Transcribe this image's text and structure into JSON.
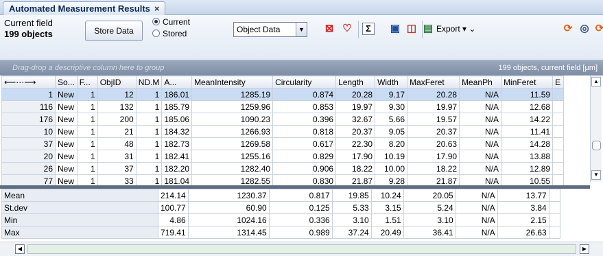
{
  "tab": {
    "title": "Automated Measurement Results",
    "close": "×"
  },
  "toolbar": {
    "field_label": "Current field",
    "objects": "199 objects",
    "store_button": "Store Data",
    "radio_current": "Current",
    "radio_stored": "Stored",
    "select_value": "Object Data",
    "export_label": "Export"
  },
  "grid": {
    "group_hint": "Drag-drop a descriptive column here to group",
    "summary": "199 objects, current field [µm]",
    "headers": [
      "⟵⋯⟶",
      "So...",
      "F...",
      "ObjID",
      "ND.M",
      "A...",
      "MeanIntensity",
      "Circularity",
      "Length",
      "Width",
      "MaxFeret",
      "MeanPh",
      "MinFeret",
      "E"
    ],
    "rows": [
      [
        "1",
        "New",
        "1",
        "12",
        "1",
        "186.01",
        "1285.19",
        "0.874",
        "20.28",
        "9.17",
        "20.28",
        "N/A",
        "11.59"
      ],
      [
        "116",
        "New",
        "1",
        "132",
        "1",
        "185.79",
        "1259.96",
        "0.853",
        "19.97",
        "9.30",
        "19.97",
        "N/A",
        "12.68"
      ],
      [
        "176",
        "New",
        "1",
        "200",
        "1",
        "185.06",
        "1090.23",
        "0.396",
        "32.67",
        "5.66",
        "19.57",
        "N/A",
        "14.22"
      ],
      [
        "10",
        "New",
        "1",
        "21",
        "1",
        "184.32",
        "1266.93",
        "0.818",
        "20.37",
        "9.05",
        "20.37",
        "N/A",
        "11.41"
      ],
      [
        "37",
        "New",
        "1",
        "48",
        "1",
        "182.73",
        "1269.58",
        "0.617",
        "22.30",
        "8.20",
        "20.63",
        "N/A",
        "14.28"
      ],
      [
        "20",
        "New",
        "1",
        "31",
        "1",
        "182.41",
        "1255.16",
        "0.829",
        "17.90",
        "10.19",
        "17.90",
        "N/A",
        "13.88"
      ],
      [
        "26",
        "New",
        "1",
        "37",
        "1",
        "182.20",
        "1282.40",
        "0.906",
        "18.22",
        "10.00",
        "18.22",
        "N/A",
        "12.89"
      ],
      [
        "77",
        "New",
        "1",
        "33",
        "1",
        "181.04",
        "1282.55",
        "0.830",
        "21.87",
        "9.28",
        "21.87",
        "N/A",
        "10.55"
      ]
    ]
  },
  "stats": {
    "rows": [
      [
        "Mean",
        "214.14",
        "1230.37",
        "0.817",
        "19.85",
        "10.24",
        "20.05",
        "N/A",
        "13.77"
      ],
      [
        "St.dev",
        "100.77",
        "60.90",
        "0.125",
        "5.33",
        "3.15",
        "5.24",
        "N/A",
        "3.84"
      ],
      [
        "Min",
        "4.86",
        "1024.16",
        "0.336",
        "3.10",
        "1.51",
        "3.10",
        "N/A",
        "2.15"
      ],
      [
        "Max",
        "719.41",
        "1314.45",
        "0.989",
        "37.24",
        "20.49",
        "36.41",
        "N/A",
        "26.63"
      ]
    ]
  },
  "icons": {
    "toolbar": [
      "delete-red-icon",
      "heart-check-icon",
      "sum-icon",
      "chart-icon",
      "table-layout-icon",
      "export-icon",
      "refresh-icon",
      "target-icon",
      "recalc-icon"
    ]
  },
  "colors": {
    "selected_row": "#c9dcf3",
    "group_bar": "#8a98ad",
    "accent_red": "#d02020"
  }
}
